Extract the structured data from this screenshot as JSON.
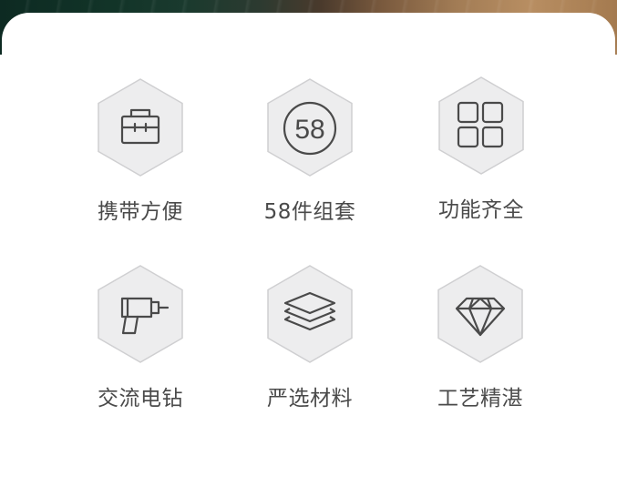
{
  "features": [
    {
      "label": "携带方便",
      "icon": "toolbox-icon"
    },
    {
      "label": "58件组套",
      "icon": "number-58-icon",
      "icon_text": "58"
    },
    {
      "label": "功能齐全",
      "icon": "grid-icon"
    },
    {
      "label": "交流电钻",
      "icon": "drill-icon"
    },
    {
      "label": "严选材料",
      "icon": "layers-icon"
    },
    {
      "label": "工艺精湛",
      "icon": "diamond-icon"
    }
  ],
  "colors": {
    "hex_fill": "#ededee",
    "hex_stroke": "#cfcfd1",
    "icon_stroke": "#4a4a4a",
    "label_text": "#4a4a4a"
  }
}
